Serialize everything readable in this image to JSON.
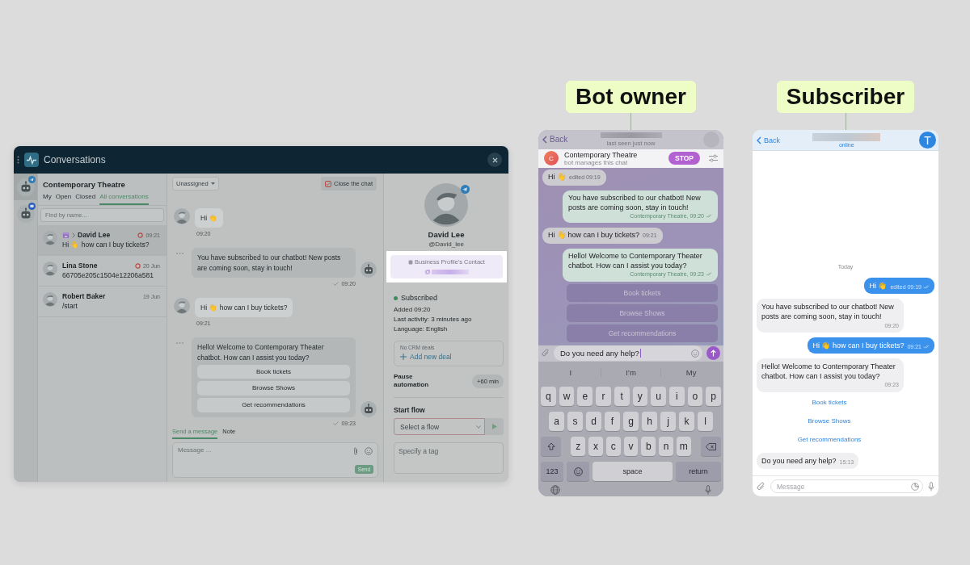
{
  "dashboard": {
    "title": "Conversations",
    "accounts": [
      {
        "kind": "telegram",
        "selected": true
      },
      {
        "kind": "messenger",
        "selected": false
      }
    ],
    "inbox": {
      "name": "Contemporary Theatre",
      "tabs": [
        {
          "label": "My",
          "selected": false
        },
        {
          "label": "Open",
          "selected": false
        },
        {
          "label": "Closed",
          "selected": false
        },
        {
          "label": "All conversations",
          "selected": true
        }
      ],
      "search": {
        "placeholder": "Find by name..."
      },
      "conversations": [
        {
          "name": "David Lee",
          "preview": "Hi 👋 how can I buy tickets?",
          "time": "09:21",
          "via_business": true,
          "flagged": true,
          "selected": true
        },
        {
          "name": "Lina Stone",
          "preview": "66705e205c1504e12206a581",
          "time": "20 Jun",
          "via_business": false,
          "flagged": true,
          "selected": false
        },
        {
          "name": "Robert Baker",
          "preview": "/start",
          "time": "19 Jun",
          "via_business": false,
          "flagged": false,
          "selected": false
        }
      ]
    },
    "chat": {
      "assignee": "Unassigned",
      "close_button": "Close the chat",
      "messages": [
        {
          "kind": "incoming",
          "text": "Hi 👋",
          "time": "09:20"
        },
        {
          "kind": "outgoing",
          "text": "You have subscribed to our chatbot! New posts are coming soon, stay in touch!",
          "time": "09:20"
        },
        {
          "kind": "incoming",
          "text": "Hi 👋 how can I buy tickets?",
          "time": "09:21"
        },
        {
          "kind": "outgoing",
          "text": "Hello! Welcome to Contemporary Theater chatbot. How can I assist you today?",
          "buttons": [
            "Book tickets",
            "Browse Shows",
            "Get recommendations"
          ],
          "time": "09:23"
        }
      ],
      "composer_tabs": [
        {
          "label": "Send a message",
          "selected": true
        },
        {
          "label": "Note",
          "selected": false
        }
      ],
      "composer": {
        "placeholder": "Message ...",
        "send": "Send"
      }
    },
    "contact": {
      "name": "David Lee",
      "username": "@David_lee",
      "business_label": "Business Profile's Contact",
      "business_handle": "@",
      "status": "Subscribed",
      "details": [
        "Added 09:20",
        "Last activity: 3 minutes ago",
        "Language: English"
      ],
      "crm_empty": "No CRM deals",
      "add_deal": "Add new deal",
      "pause_label": "Pause automation",
      "pause_button": "+60 min",
      "flow_label": "Start flow",
      "flow_select": {
        "placeholder": "Select a flow"
      },
      "tag_field": {
        "placeholder": "Specify a tag"
      }
    }
  },
  "bot_owner": {
    "label": "Bot owner",
    "back": "Back",
    "last_seen": "last seen just now",
    "banner": {
      "avatar_letter": "C",
      "name": "Contemporary Theatre",
      "subtitle": "bot manages this chat",
      "stop": "STOP"
    },
    "messages": [
      {
        "kind": "incoming",
        "text": "Hi 👋",
        "meta": "edited 09:19"
      },
      {
        "kind": "outgoing",
        "text": "You have subscribed to our chatbot! New posts are coming soon, stay in touch!",
        "meta": "Contemporary Theatre, 09:20"
      },
      {
        "kind": "incoming",
        "text": "Hi 👋 how can I buy tickets?",
        "meta": "09:21"
      },
      {
        "kind": "outgoing",
        "text": "Hello! Welcome to Contemporary Theater chatbot. How can I assist you today?",
        "meta": "Contemporary Theatre, 09:23"
      },
      {
        "kind": "buttons",
        "buttons": [
          "Book tickets",
          "Browse Shows",
          "Get recommendations"
        ]
      }
    ],
    "input": {
      "value": "Do you need any help?"
    },
    "suggestions": [
      "I",
      "I’m",
      "My"
    ],
    "keys": [
      [
        {
          "kind": "letter",
          "label": "q"
        },
        {
          "kind": "letter",
          "label": "w"
        },
        {
          "kind": "letter",
          "label": "e"
        },
        {
          "kind": "letter",
          "label": "r"
        },
        {
          "kind": "letter",
          "label": "t"
        },
        {
          "kind": "letter",
          "label": "y"
        },
        {
          "kind": "letter",
          "label": "u"
        },
        {
          "kind": "letter",
          "label": "i"
        },
        {
          "kind": "letter",
          "label": "o"
        },
        {
          "kind": "letter",
          "label": "p"
        }
      ],
      [
        {
          "kind": "letter",
          "label": "a"
        },
        {
          "kind": "letter",
          "label": "s"
        },
        {
          "kind": "letter",
          "label": "d"
        },
        {
          "kind": "letter",
          "label": "f"
        },
        {
          "kind": "letter",
          "label": "g"
        },
        {
          "kind": "letter",
          "label": "h"
        },
        {
          "kind": "letter",
          "label": "j"
        },
        {
          "kind": "letter",
          "label": "k"
        },
        {
          "kind": "letter",
          "label": "l"
        }
      ],
      [
        {
          "kind": "shift"
        },
        {
          "kind": "letter",
          "label": "z"
        },
        {
          "kind": "letter",
          "label": "x"
        },
        {
          "kind": "letter",
          "label": "c"
        },
        {
          "kind": "letter",
          "label": "v"
        },
        {
          "kind": "letter",
          "label": "b"
        },
        {
          "kind": "letter",
          "label": "n"
        },
        {
          "kind": "letter",
          "label": "m"
        },
        {
          "kind": "delete"
        }
      ],
      [
        {
          "kind": "function",
          "label": "123"
        },
        {
          "kind": "emoji"
        },
        {
          "kind": "space",
          "label": "space"
        },
        {
          "kind": "function",
          "label": "return"
        }
      ]
    ]
  },
  "subscriber": {
    "label": "Subscriber",
    "back": "Back",
    "status": "online",
    "avatar_letter": "T",
    "date": "Today",
    "messages": [
      {
        "kind": "outgoing",
        "text": "Hi 👋",
        "meta": "edited 09:19"
      },
      {
        "kind": "incoming",
        "text": "You have subscribed to our chatbot! New posts are coming soon, stay in touch!",
        "meta": "09:20"
      },
      {
        "kind": "outgoing",
        "text": "Hi 👋 how can I buy tickets?",
        "meta": "09:21"
      },
      {
        "kind": "incoming",
        "text": "Hello! Welcome to Contemporary Theater chatbot. How can I assist you today?",
        "meta": "09:23"
      },
      {
        "kind": "buttons",
        "buttons": [
          "Book tickets",
          "Browse Shows",
          "Get recommendations"
        ]
      },
      {
        "kind": "incoming",
        "text": "Do you need any help?",
        "meta": "15:13"
      }
    ],
    "composer": {
      "placeholder": "Message"
    }
  }
}
